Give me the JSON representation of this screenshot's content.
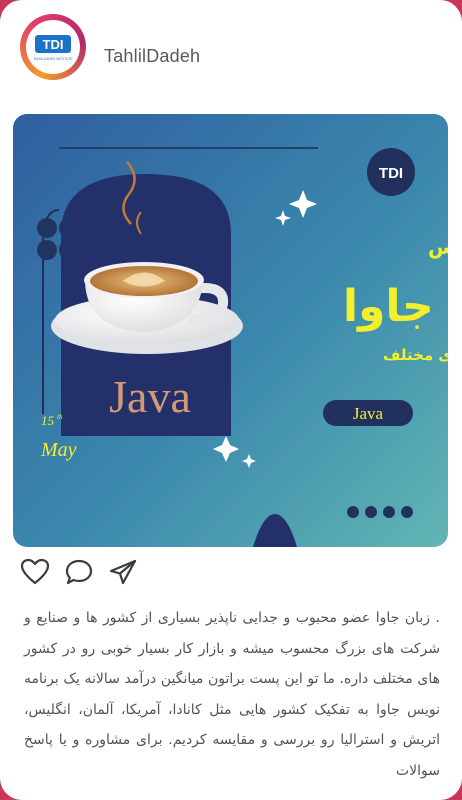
{
  "profile": {
    "username": "TahlilDadeh",
    "logo_text": "TDI",
    "logo_subtext": "TAHLILDADEH INSTITUTE"
  },
  "post": {
    "logo_text": "TDI",
    "title_line": "درآمد برنامه نویس",
    "big_word": "جاوا",
    "subtitle": "در کشور های مختلف",
    "cup_label": "Java",
    "badge_label": "Java",
    "date_day": "15",
    "date_suffix": "th",
    "date_month": "May"
  },
  "actions": {
    "like_icon": "heart-icon",
    "comment_icon": "comment-icon",
    "share_icon": "send-icon"
  },
  "caption": {
    "text": ". زبان جاوا عضو محبوب و جدایی ناپذیر بسیاری از کشور ها و صنایع و شرکت های بزرگ محسوب میشه و بازار کار بسیار خوبی رو در کشور های مختلف داره. ما تو این پست براتون میانگین درآمد سالانه یک برنامه نویس جاوا به تفکیک کشور هایی مثل کانادا، آمریکا، آلمان، انگلیس، اتریش و استرالیا رو بررسی و مقایسه کردیم. برای مشاوره و یا پاسخ سوالات"
  },
  "colors": {
    "brand_ring_start": "#f39c2c",
    "brand_ring_end": "#b5256f",
    "post_bg_start": "#2f5fa0",
    "post_bg_end": "#5fb0b2",
    "headline_yellow": "#f3ef2b",
    "arch_navy": "#22305e",
    "java_text": "#d39a74"
  }
}
